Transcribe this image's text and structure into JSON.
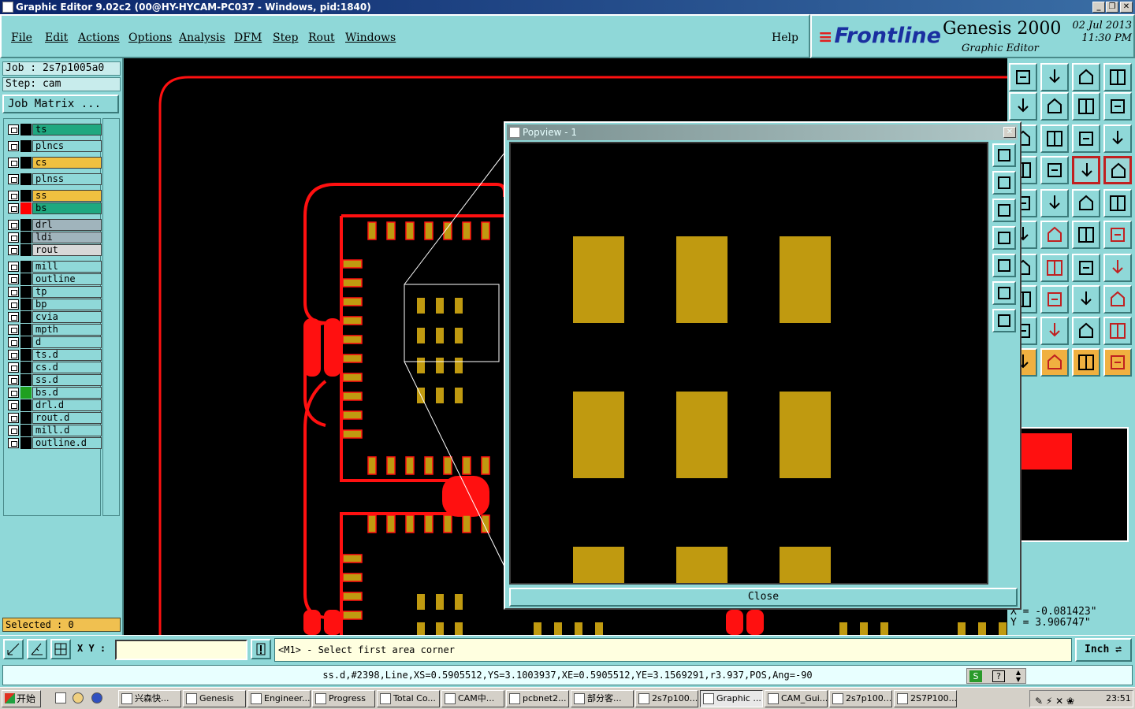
{
  "window": {
    "title": "Graphic Editor 9.02c2 (00@HY-HYCAM-PC037 - Windows, pid:1840)",
    "min": "_",
    "max": "❐",
    "close": "✕"
  },
  "menu": {
    "items": [
      "File",
      "Edit",
      "Actions",
      "Options",
      "Analysis",
      "DFM",
      "Step",
      "Rout",
      "Windows"
    ],
    "help": "Help"
  },
  "brand": {
    "logo": "Frontline",
    "product": "Genesis 2000",
    "subtitle": "Graphic Editor",
    "date": "02 Jul 2013",
    "time": "11:30 PM"
  },
  "job": {
    "job_line": "Job : 2s7p1005a0",
    "step_line": "Step: cam",
    "matrix_button": "Job Matrix ..."
  },
  "layers": [
    {
      "name": "ts",
      "color": "#1fa880",
      "mark": "#000000"
    },
    {
      "name": "plncs",
      "color": "#8fd8d8",
      "mark": "#000000"
    },
    {
      "name": "cs",
      "color": "#f0c040",
      "mark": "#000000"
    },
    {
      "name": "plnss",
      "color": "#8fd8d8",
      "mark": "#000000"
    },
    {
      "name": "ss",
      "color": "#f0c040",
      "mark": "#000000"
    },
    {
      "name": "bs",
      "color": "#1fa880",
      "mark": "#ff0000"
    },
    {
      "name": "drl",
      "color": "#a0b4bc",
      "mark": "#000000"
    },
    {
      "name": "ldi",
      "color": "#a0b4bc",
      "mark": "#000000"
    },
    {
      "name": "rout",
      "color": "#d8d8d8",
      "mark": "#000000"
    },
    {
      "name": "mill",
      "color": "#8fd8d8",
      "mark": "#000000"
    },
    {
      "name": "outline",
      "color": "#8fd8d8",
      "mark": "#000000"
    },
    {
      "name": "tp",
      "color": "#8fd8d8",
      "mark": "#000000"
    },
    {
      "name": "bp",
      "color": "#8fd8d8",
      "mark": "#000000"
    },
    {
      "name": "cvia",
      "color": "#8fd8d8",
      "mark": "#000000"
    },
    {
      "name": "mpth",
      "color": "#8fd8d8",
      "mark": "#000000"
    },
    {
      "name": "d",
      "color": "#8fd8d8",
      "mark": "#000000"
    },
    {
      "name": "ts.d",
      "color": "#8fd8d8",
      "mark": "#000000"
    },
    {
      "name": "cs.d",
      "color": "#8fd8d8",
      "mark": "#000000"
    },
    {
      "name": "ss.d",
      "color": "#8fd8d8",
      "mark": "#000000"
    },
    {
      "name": "bs.d",
      "color": "#8fd8d8",
      "mark": "#1fa020"
    },
    {
      "name": "drl.d",
      "color": "#8fd8d8",
      "mark": "#000000"
    },
    {
      "name": "rout.d",
      "color": "#8fd8d8",
      "mark": "#000000"
    },
    {
      "name": "mill.d",
      "color": "#8fd8d8",
      "mark": "#000000"
    },
    {
      "name": "outline.d",
      "color": "#8fd8d8",
      "mark": "#000000"
    }
  ],
  "selected": "Selected : 0",
  "popview": {
    "title": "Popview - 1",
    "close_x": "✕",
    "close_button": "Close"
  },
  "coords": {
    "x": "X = -0.081423\"",
    "y": "Y = 3.906747\""
  },
  "command": {
    "xy_label": "X Y :",
    "xy_value": "",
    "prompt": "<M1> - Select first area corner",
    "units": "Inch"
  },
  "status": "ss.d,#2398,Line,XS=0.5905512,YS=3.1003937,XE=0.5905512,YE=3.1569291,r3.937,POS,Ang=-90",
  "taskbar": {
    "start": "开始",
    "tasks": [
      "兴森快...",
      "Genesis",
      "Engineer...",
      "Progress",
      "Total Co...",
      "CAM中...",
      "pcbnet2...",
      "部分客...",
      "2s7p100...",
      "Graphic ...",
      "CAM_Gui...",
      "2s7p100...",
      "2S7P100..."
    ],
    "clock": "23:51"
  },
  "colors": {
    "trace": "#ff1010",
    "pad": "#c09a10",
    "panel": "#8fd8d8"
  }
}
